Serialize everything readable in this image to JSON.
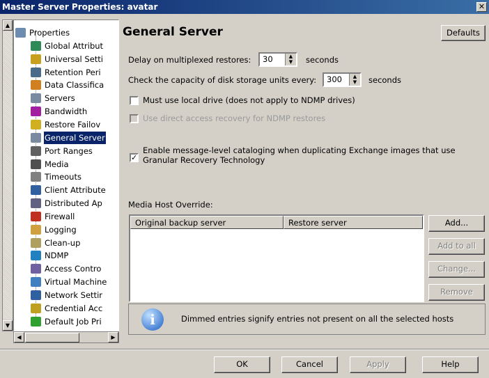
{
  "window": {
    "title": "Master Server Properties: avatar",
    "close": "✕"
  },
  "tree": {
    "items": [
      {
        "label": "Properties",
        "icon": "properties-icon",
        "color": "#6e8cb0"
      },
      {
        "label": "Global Attribut",
        "icon": "globe-icon",
        "color": "#2e8b57"
      },
      {
        "label": "Universal Setti",
        "icon": "universal-settings-icon",
        "color": "#c8a020"
      },
      {
        "label": "Retention Peri",
        "icon": "retention-icon",
        "color": "#4a6a8a"
      },
      {
        "label": "Data Classifica",
        "icon": "data-classification-icon",
        "color": "#d08020"
      },
      {
        "label": "Servers",
        "icon": "servers-icon",
        "color": "#7a8aa0"
      },
      {
        "label": "Bandwidth",
        "icon": "bandwidth-icon",
        "color": "#a020a0"
      },
      {
        "label": "Restore Failov",
        "icon": "restore-failover-icon",
        "color": "#d0b020"
      },
      {
        "label": "General Server",
        "icon": "general-server-icon",
        "color": "#7a8aa0"
      },
      {
        "label": "Port Ranges",
        "icon": "port-ranges-icon",
        "color": "#606060"
      },
      {
        "label": "Media",
        "icon": "media-icon",
        "color": "#505050"
      },
      {
        "label": "Timeouts",
        "icon": "timeouts-icon",
        "color": "#808080"
      },
      {
        "label": "Client Attribute",
        "icon": "client-attributes-icon",
        "color": "#3060a0"
      },
      {
        "label": "Distributed Ap",
        "icon": "distributed-app-icon",
        "color": "#606080"
      },
      {
        "label": "Firewall",
        "icon": "firewall-icon",
        "color": "#c03020"
      },
      {
        "label": "Logging",
        "icon": "logging-icon",
        "color": "#d0a040"
      },
      {
        "label": "Clean-up",
        "icon": "cleanup-icon",
        "color": "#b0a060"
      },
      {
        "label": "NDMP",
        "icon": "ndmp-icon",
        "color": "#2080c0"
      },
      {
        "label": "Access Contro",
        "icon": "access-control-icon",
        "color": "#7060a0"
      },
      {
        "label": "Virtual Machine",
        "icon": "virtual-machine-icon",
        "color": "#4080c0"
      },
      {
        "label": "Network Settir",
        "icon": "network-settings-icon",
        "color": "#3060a0"
      },
      {
        "label": "Credential Acc",
        "icon": "credential-access-icon",
        "color": "#c0a020"
      },
      {
        "label": "Default Job Pri",
        "icon": "default-job-priority-icon",
        "color": "#30a030"
      }
    ],
    "selected_index": 8
  },
  "main": {
    "heading": "General Server",
    "defaults_button": "Defaults",
    "delay_label": "Delay on multiplexed restores:",
    "delay_value": "30",
    "delay_unit": "seconds",
    "capacity_label": "Check the capacity of disk storage units every:",
    "capacity_value": "300",
    "capacity_unit": "seconds",
    "local_drive_label": "Must use local drive (does not apply to NDMP drives)",
    "local_drive_checked": false,
    "direct_access_label": "Use direct access recovery for NDMP restores",
    "direct_access_checked": false,
    "catalog_label_line1": "Enable message-level cataloging when duplicating Exchange images that use",
    "catalog_label_line2": "Granular Recovery Technology",
    "catalog_checked": true,
    "media_host_label": "Media Host Override:",
    "columns": [
      "Original backup server",
      "Restore server"
    ],
    "rows": [],
    "add_button": "Add...",
    "add_all_button": "Add to all",
    "change_button": "Change...",
    "remove_button": "Remove",
    "info_icon": "i",
    "info_text": "Dimmed entries signify entries not present on all the selected hosts"
  },
  "footer": {
    "ok": "OK",
    "cancel": "Cancel",
    "apply": "Apply",
    "help": "Help"
  }
}
